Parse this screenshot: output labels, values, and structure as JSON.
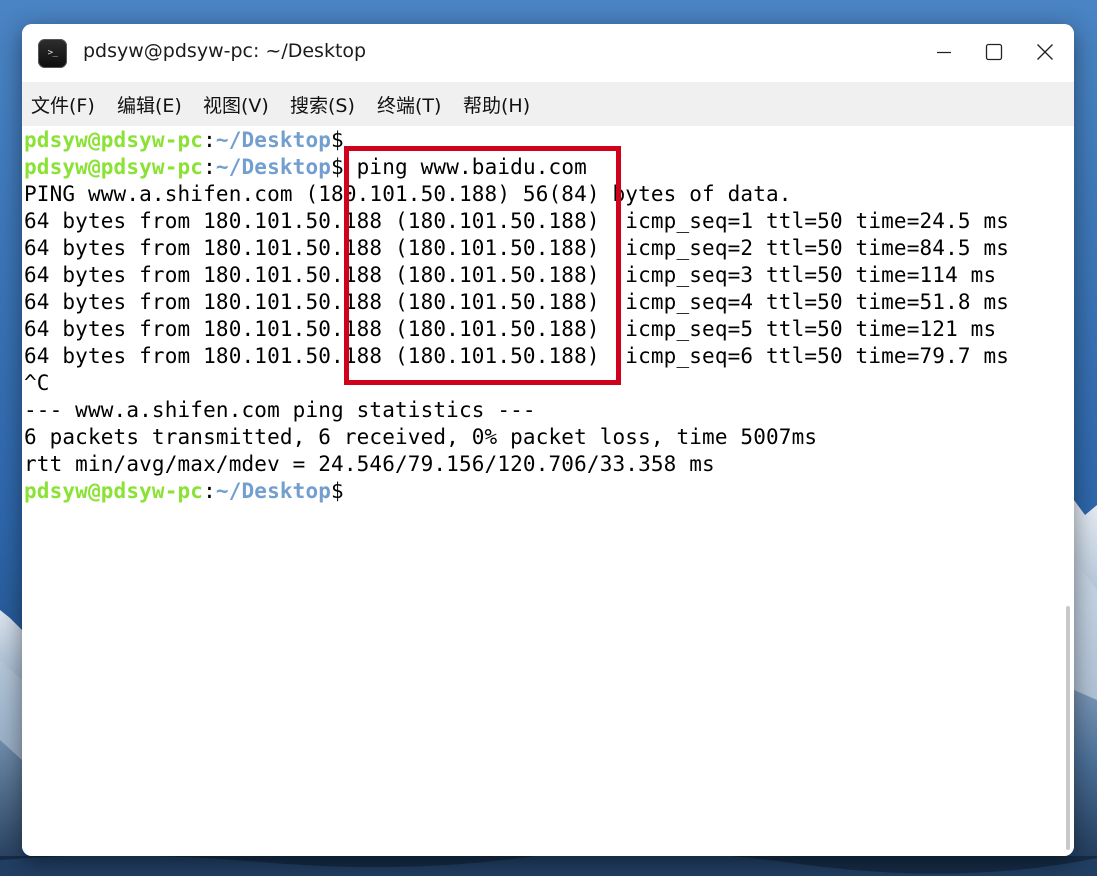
{
  "window": {
    "title": "pdsyw@pdsyw-pc: ~/Desktop",
    "icon_glyph": ">_",
    "controls": {
      "minimize_icon": "minimize-icon",
      "maximize_icon": "maximize-icon",
      "close_icon": "close-icon"
    }
  },
  "menu": {
    "items": [
      {
        "label": "文件(F)"
      },
      {
        "label": "编辑(E)"
      },
      {
        "label": "视图(V)"
      },
      {
        "label": "搜索(S)"
      },
      {
        "label": "终端(T)"
      },
      {
        "label": "帮助(H)"
      }
    ]
  },
  "prompt": {
    "user": "pdsyw@pdsyw-pc",
    "colon": ":",
    "path": "~/Desktop",
    "dollar": "$"
  },
  "terminal": {
    "command": " ping www.baidu.com",
    "output": [
      "PING www.a.shifen.com (180.101.50.188) 56(84) bytes of data.",
      "64 bytes from 180.101.50.188 (180.101.50.188)  icmp_seq=1 ttl=50 time=24.5 ms",
      "64 bytes from 180.101.50.188 (180.101.50.188)  icmp_seq=2 ttl=50 time=84.5 ms",
      "64 bytes from 180.101.50.188 (180.101.50.188)  icmp_seq=3 ttl=50 time=114 ms",
      "64 bytes from 180.101.50.188 (180.101.50.188)  icmp_seq=4 ttl=50 time=51.8 ms",
      "64 bytes from 180.101.50.188 (180.101.50.188)  icmp_seq=5 ttl=50 time=121 ms",
      "64 bytes from 180.101.50.188 (180.101.50.188)  icmp_seq=6 ttl=50 time=79.7 ms",
      "^C",
      "--- www.a.shifen.com ping statistics ---",
      "6 packets transmitted, 6 received, 0% packet loss, time 5007ms",
      "rtt min/avg/max/mdev = 24.546/79.156/120.706/33.358 ms"
    ]
  },
  "colors": {
    "prompt_user": "#8ae234",
    "prompt_path": "#729fcf",
    "highlight_box": "#d0021b",
    "menubar_bg": "#f0f0f0"
  }
}
